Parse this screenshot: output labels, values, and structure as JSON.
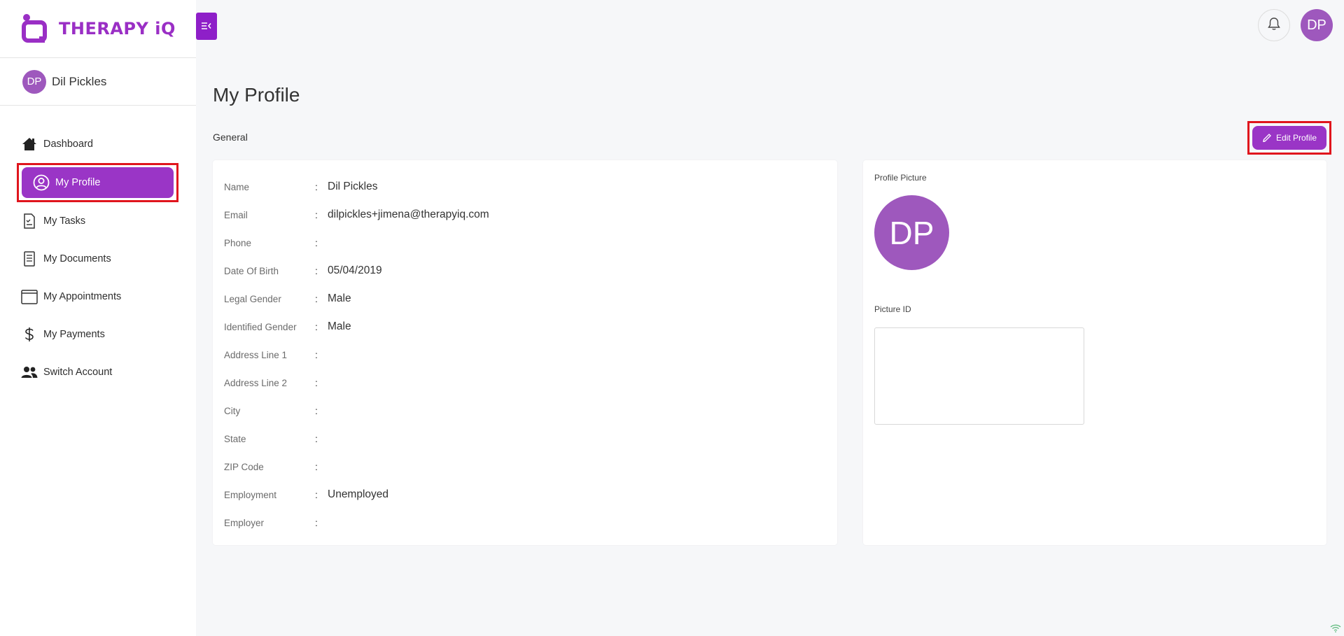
{
  "brand": {
    "name": "THERAPY iQ",
    "accent": "#9a35c6",
    "logo_color": "#9a2fc5"
  },
  "sidebar": {
    "user": {
      "initials": "DP",
      "name": "Dil Pickles"
    },
    "items": [
      {
        "label": "Dashboard",
        "icon": "home-icon",
        "active": false
      },
      {
        "label": "My Profile",
        "icon": "user-circle-icon",
        "active": true
      },
      {
        "label": "My Tasks",
        "icon": "task-document-icon",
        "active": false
      },
      {
        "label": "My Documents",
        "icon": "document-icon",
        "active": false
      },
      {
        "label": "My Appointments",
        "icon": "calendar-icon",
        "active": false
      },
      {
        "label": "My Payments",
        "icon": "dollar-icon",
        "active": false
      },
      {
        "label": "Switch Account",
        "icon": "users-icon",
        "active": false
      }
    ]
  },
  "header": {
    "toggle_icon": "collapse-menu-icon",
    "bell_icon": "bell-icon",
    "avatar_initials": "DP"
  },
  "main": {
    "title": "My Profile",
    "section": "General",
    "edit_button": "Edit Profile",
    "fields": [
      {
        "label": "Name",
        "value": "Dil Pickles"
      },
      {
        "label": "Email",
        "value": "dilpickles+jimena@therapyiq.com"
      },
      {
        "label": "Phone",
        "value": ""
      },
      {
        "label": "Date Of Birth",
        "value": "05/04/2019"
      },
      {
        "label": "Legal Gender",
        "value": "Male"
      },
      {
        "label": "Identified Gender",
        "value": "Male"
      },
      {
        "label": "Address Line 1",
        "value": ""
      },
      {
        "label": "Address Line 2",
        "value": ""
      },
      {
        "label": "City",
        "value": ""
      },
      {
        "label": "State",
        "value": ""
      },
      {
        "label": "ZIP Code",
        "value": ""
      },
      {
        "label": "Employment",
        "value": "Unemployed"
      },
      {
        "label": "Employer",
        "value": ""
      }
    ],
    "profile_picture": {
      "label": "Profile Picture",
      "initials": "DP"
    },
    "picture_id": {
      "label": "Picture ID"
    }
  }
}
